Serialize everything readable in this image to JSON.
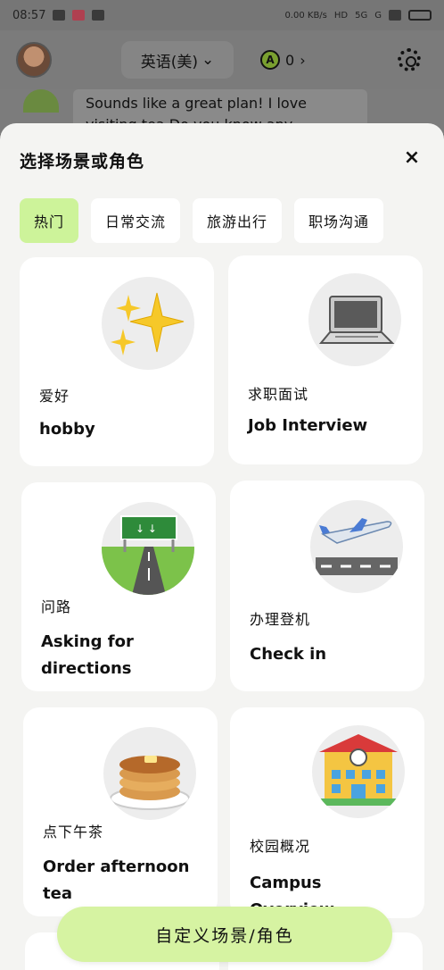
{
  "status_bar": {
    "time": "08:57",
    "net_speed": "0.00 KB/s",
    "hd": "HD",
    "signal_1": "5G",
    "signal_2": "G"
  },
  "header": {
    "language": "英语(美)",
    "coins": "0"
  },
  "chat": {
    "preview": "Sounds like a great plan! I love visiting tea Do you know any"
  },
  "sheet": {
    "title": "选择场景或角色",
    "close": "×",
    "tabs": [
      {
        "label": "热门"
      },
      {
        "label": "日常交流"
      },
      {
        "label": "旅游出行"
      },
      {
        "label": "职场沟通"
      }
    ],
    "cards": [
      {
        "cn": "爱好",
        "en": "hobby",
        "icon": "sparkles-icon"
      },
      {
        "cn": "求职面试",
        "en": "Job Interview",
        "icon": "laptop-icon"
      },
      {
        "cn": "问路",
        "en": "Asking for directions",
        "icon": "road-sign-icon"
      },
      {
        "cn": "办理登机",
        "en": "Check in",
        "icon": "airplane-icon"
      },
      {
        "cn": "点下午茶",
        "en": "Order afternoon tea",
        "icon": "pancakes-icon"
      },
      {
        "cn": "校园概况",
        "en": "Campus Overview",
        "icon": "school-icon"
      }
    ],
    "cta": "自定义场景/角色"
  },
  "colors": {
    "accent": "#cdf39a",
    "sheet_bg": "#f4f4f2",
    "card_bg": "#ffffff"
  }
}
